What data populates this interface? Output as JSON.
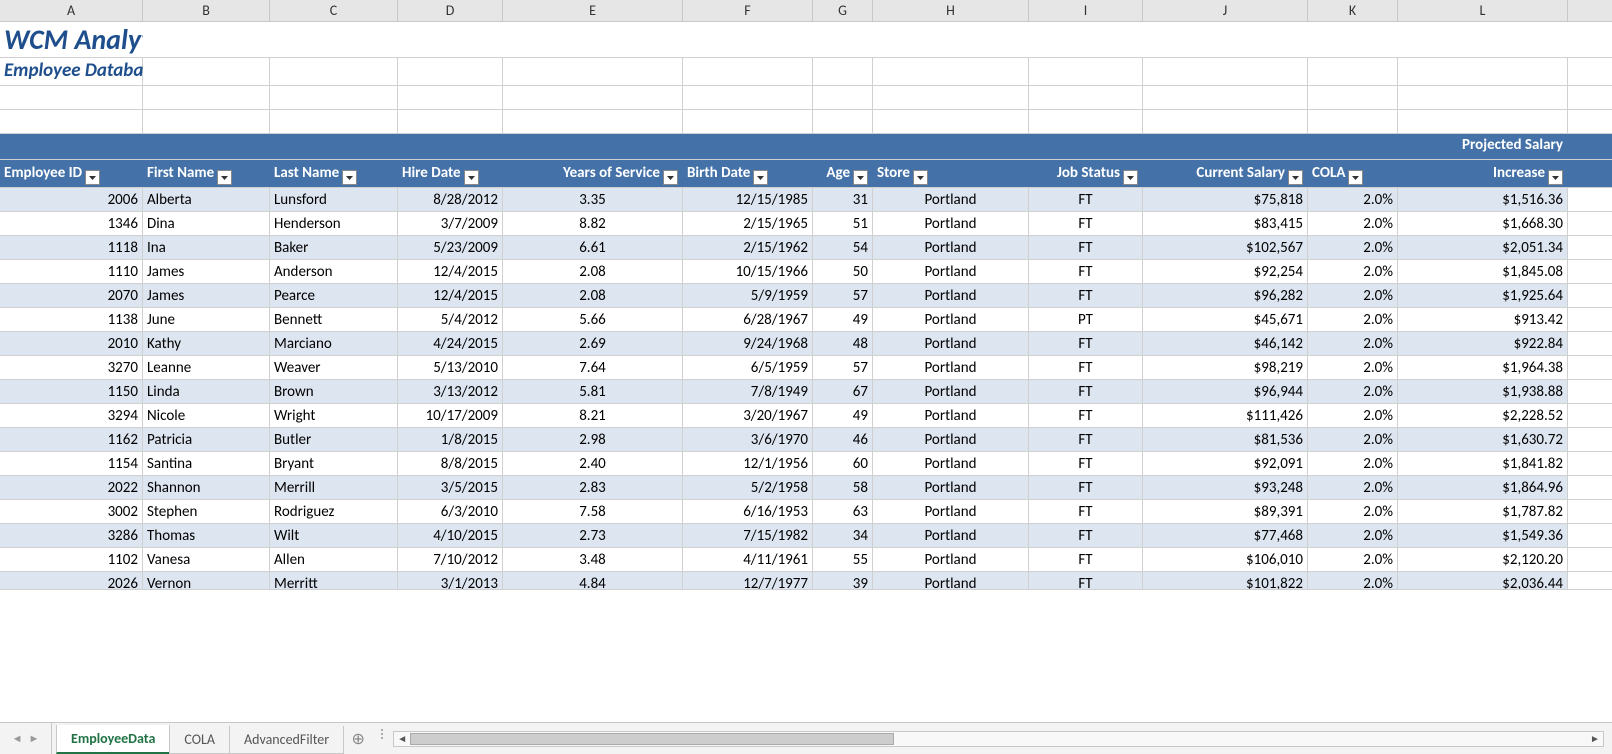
{
  "columns": [
    "A",
    "B",
    "C",
    "D",
    "E",
    "F",
    "G",
    "H",
    "I",
    "J",
    "K",
    "L"
  ],
  "title": "WCM Analytics",
  "subtitle": "Employee Database",
  "header_top": {
    "L": "Projected Salary"
  },
  "headers": {
    "A": "Employee ID",
    "B": "First Name",
    "C": "Last Name",
    "D": "Hire Date",
    "E": "Years of Service",
    "F": "Birth Date",
    "G": "Age",
    "H": "Store",
    "I": "Job Status",
    "J": "Current Salary",
    "K": "COLA",
    "L": "Increase"
  },
  "rows": [
    {
      "id": "2006",
      "first": "Alberta",
      "last": "Lunsford",
      "hire": "8/28/2012",
      "yos": "3.35",
      "birth": "12/15/1985",
      "age": "31",
      "store": "Portland",
      "status": "FT",
      "salary": "$75,818",
      "cola": "2.0%",
      "proj": "$1,516.36"
    },
    {
      "id": "1346",
      "first": "Dina",
      "last": "Henderson",
      "hire": "3/7/2009",
      "yos": "8.82",
      "birth": "2/15/1965",
      "age": "51",
      "store": "Portland",
      "status": "FT",
      "salary": "$83,415",
      "cola": "2.0%",
      "proj": "$1,668.30"
    },
    {
      "id": "1118",
      "first": "Ina",
      "last": "Baker",
      "hire": "5/23/2009",
      "yos": "6.61",
      "birth": "2/15/1962",
      "age": "54",
      "store": "Portland",
      "status": "FT",
      "salary": "$102,567",
      "cola": "2.0%",
      "proj": "$2,051.34"
    },
    {
      "id": "1110",
      "first": "James",
      "last": "Anderson",
      "hire": "12/4/2015",
      "yos": "2.08",
      "birth": "10/15/1966",
      "age": "50",
      "store": "Portland",
      "status": "FT",
      "salary": "$92,254",
      "cola": "2.0%",
      "proj": "$1,845.08"
    },
    {
      "id": "2070",
      "first": "James",
      "last": "Pearce",
      "hire": "12/4/2015",
      "yos": "2.08",
      "birth": "5/9/1959",
      "age": "57",
      "store": "Portland",
      "status": "FT",
      "salary": "$96,282",
      "cola": "2.0%",
      "proj": "$1,925.64"
    },
    {
      "id": "1138",
      "first": "June",
      "last": "Bennett",
      "hire": "5/4/2012",
      "yos": "5.66",
      "birth": "6/28/1967",
      "age": "49",
      "store": "Portland",
      "status": "PT",
      "salary": "$45,671",
      "cola": "2.0%",
      "proj": "$913.42"
    },
    {
      "id": "2010",
      "first": "Kathy",
      "last": "Marciano",
      "hire": "4/24/2015",
      "yos": "2.69",
      "birth": "9/24/1968",
      "age": "48",
      "store": "Portland",
      "status": "FT",
      "salary": "$46,142",
      "cola": "2.0%",
      "proj": "$922.84"
    },
    {
      "id": "3270",
      "first": "Leanne",
      "last": "Weaver",
      "hire": "5/13/2010",
      "yos": "7.64",
      "birth": "6/5/1959",
      "age": "57",
      "store": "Portland",
      "status": "FT",
      "salary": "$98,219",
      "cola": "2.0%",
      "proj": "$1,964.38"
    },
    {
      "id": "1150",
      "first": "Linda",
      "last": "Brown",
      "hire": "3/13/2012",
      "yos": "5.81",
      "birth": "7/8/1949",
      "age": "67",
      "store": "Portland",
      "status": "FT",
      "salary": "$96,944",
      "cola": "2.0%",
      "proj": "$1,938.88"
    },
    {
      "id": "3294",
      "first": "Nicole",
      "last": "Wright",
      "hire": "10/17/2009",
      "yos": "8.21",
      "birth": "3/20/1967",
      "age": "49",
      "store": "Portland",
      "status": "FT",
      "salary": "$111,426",
      "cola": "2.0%",
      "proj": "$2,228.52"
    },
    {
      "id": "1162",
      "first": "Patricia",
      "last": "Butler",
      "hire": "1/8/2015",
      "yos": "2.98",
      "birth": "3/6/1970",
      "age": "46",
      "store": "Portland",
      "status": "FT",
      "salary": "$81,536",
      "cola": "2.0%",
      "proj": "$1,630.72"
    },
    {
      "id": "1154",
      "first": "Santina",
      "last": "Bryant",
      "hire": "8/8/2015",
      "yos": "2.40",
      "birth": "12/1/1956",
      "age": "60",
      "store": "Portland",
      "status": "FT",
      "salary": "$92,091",
      "cola": "2.0%",
      "proj": "$1,841.82"
    },
    {
      "id": "2022",
      "first": "Shannon",
      "last": "Merrill",
      "hire": "3/5/2015",
      "yos": "2.83",
      "birth": "5/2/1958",
      "age": "58",
      "store": "Portland",
      "status": "FT",
      "salary": "$93,248",
      "cola": "2.0%",
      "proj": "$1,864.96"
    },
    {
      "id": "3002",
      "first": "Stephen",
      "last": "Rodriguez",
      "hire": "6/3/2010",
      "yos": "7.58",
      "birth": "6/16/1953",
      "age": "63",
      "store": "Portland",
      "status": "FT",
      "salary": "$89,391",
      "cola": "2.0%",
      "proj": "$1,787.82"
    },
    {
      "id": "3286",
      "first": "Thomas",
      "last": "Wilt",
      "hire": "4/10/2015",
      "yos": "2.73",
      "birth": "7/15/1982",
      "age": "34",
      "store": "Portland",
      "status": "FT",
      "salary": "$77,468",
      "cola": "2.0%",
      "proj": "$1,549.36"
    },
    {
      "id": "1102",
      "first": "Vanesa",
      "last": "Allen",
      "hire": "7/10/2012",
      "yos": "3.48",
      "birth": "4/11/1961",
      "age": "55",
      "store": "Portland",
      "status": "FT",
      "salary": "$106,010",
      "cola": "2.0%",
      "proj": "$2,120.20"
    },
    {
      "id": "2026",
      "first": "Vernon",
      "last": "Merritt",
      "hire": "3/1/2013",
      "yos": "4.84",
      "birth": "12/7/1977",
      "age": "39",
      "store": "Portland",
      "status": "FT",
      "salary": "$101,822",
      "cola": "2.0%",
      "proj": "$2,036.44"
    }
  ],
  "tabs": [
    {
      "label": "EmployeeData",
      "active": true
    },
    {
      "label": "COLA",
      "active": false
    },
    {
      "label": "AdvancedFilter",
      "active": false
    }
  ]
}
